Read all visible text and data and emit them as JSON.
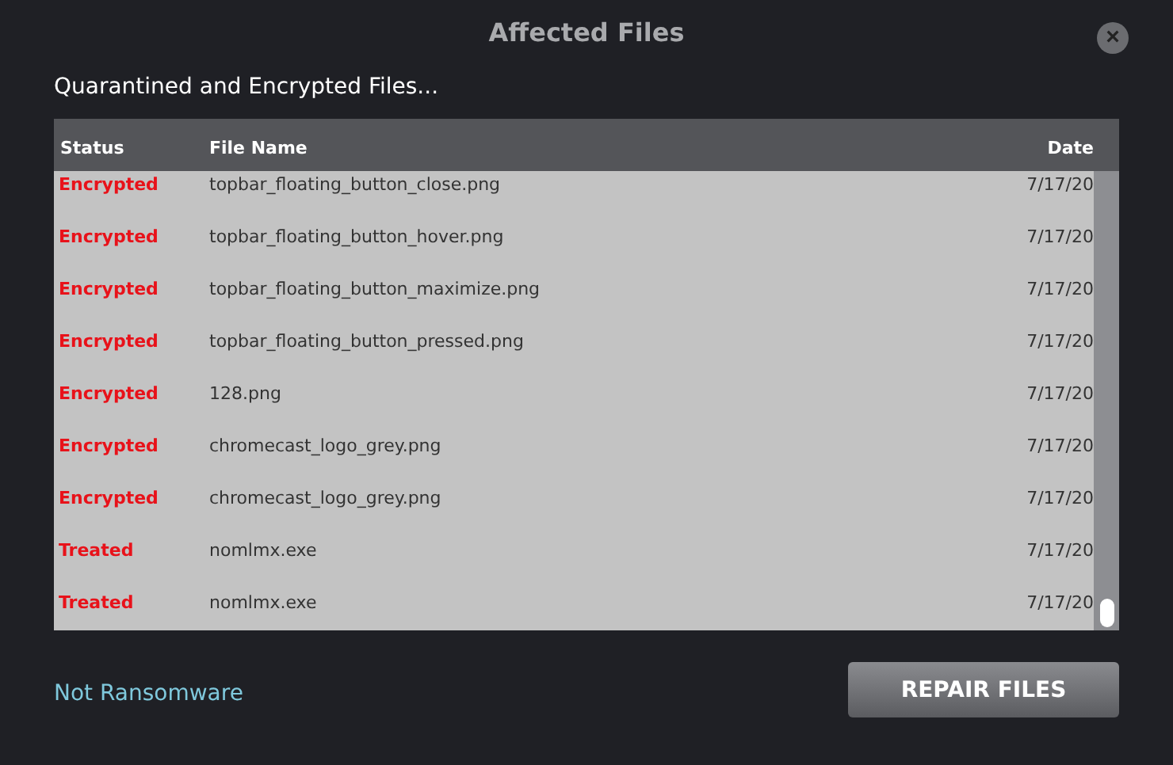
{
  "window": {
    "title": "Affected Files",
    "close": "×"
  },
  "subtitle": "Quarantined and Encrypted Files...",
  "table": {
    "columns": [
      "Status",
      "File Name",
      "Date"
    ],
    "rows": [
      {
        "status": "Encrypted",
        "file": "topbar_floating_button_close.png",
        "date": "7/17/20"
      },
      {
        "status": "Encrypted",
        "file": "topbar_floating_button_hover.png",
        "date": "7/17/20"
      },
      {
        "status": "Encrypted",
        "file": "topbar_floating_button_maximize.png",
        "date": "7/17/20"
      },
      {
        "status": "Encrypted",
        "file": "topbar_floating_button_pressed.png",
        "date": "7/17/20"
      },
      {
        "status": "Encrypted",
        "file": "128.png",
        "date": "7/17/20"
      },
      {
        "status": "Encrypted",
        "file": "chromecast_logo_grey.png",
        "date": "7/17/20"
      },
      {
        "status": "Encrypted",
        "file": "chromecast_logo_grey.png",
        "date": "7/17/20"
      },
      {
        "status": "Treated",
        "file": "nomlmx.exe",
        "date": "7/17/20"
      },
      {
        "status": "Treated",
        "file": "nomlmx.exe",
        "date": "7/17/20"
      }
    ]
  },
  "link": "Not Ransomware",
  "button": "REPAIR FILES"
}
